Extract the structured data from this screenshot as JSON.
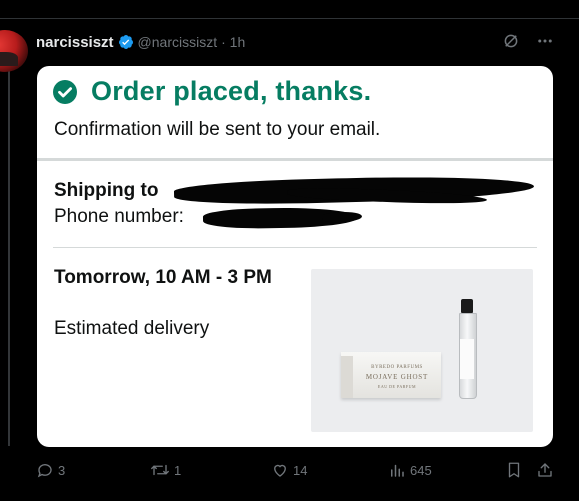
{
  "tweet": {
    "display_name": "narcissiszt",
    "handle": "@narcissiszt",
    "time": "· 1h"
  },
  "card": {
    "title": "Order placed, thanks.",
    "confirmation": "Confirmation will be sent to your email.",
    "shipping_label": "Shipping to",
    "phone_label": "Phone number:",
    "delivery_window": "Tomorrow, 10 AM - 3 PM",
    "delivery_caption": "Estimated delivery",
    "product": {
      "brand": "BYREDO PARFUMS",
      "name": "MOJAVE GHOST",
      "type": "EAU DE PARFUM"
    }
  },
  "actions": {
    "replies": "3",
    "reposts": "1",
    "likes": "14",
    "views": "645"
  },
  "colors": {
    "background": "#000000",
    "muted": "#71767b",
    "verified": "#1d9bf0",
    "success_green": "#067d62"
  },
  "icons": {
    "verified": "verified-badge-icon",
    "grok": "grok-icon",
    "more": "more-icon",
    "check": "check-circle-icon",
    "reply": "reply-icon",
    "repost": "repost-icon",
    "like": "heart-icon",
    "views": "views-icon",
    "bookmark": "bookmark-icon",
    "share": "share-icon"
  }
}
